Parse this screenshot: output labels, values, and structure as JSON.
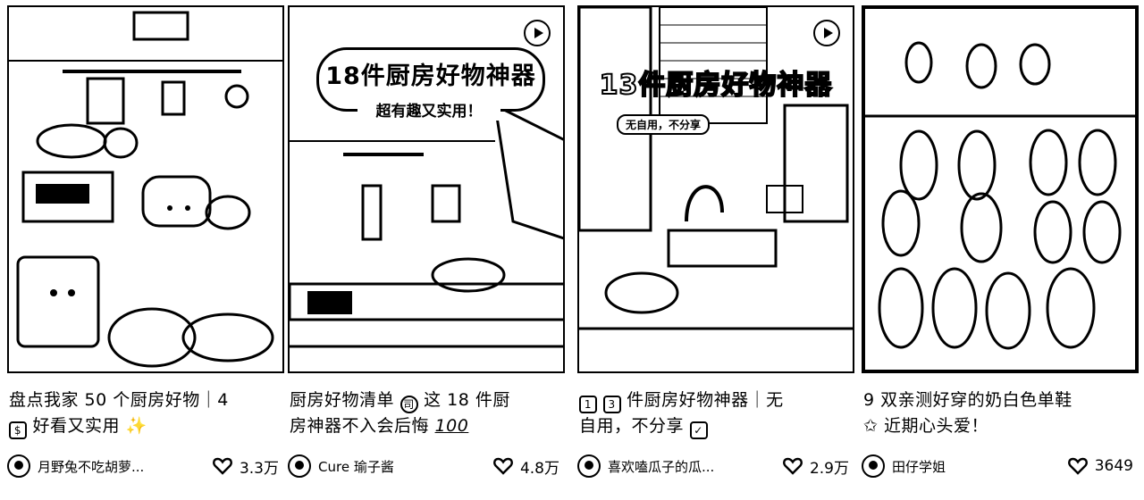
{
  "cards": [
    {
      "title_line1": "盘点我家 50 个厨房好物｜4",
      "title_line2": "好看又实用",
      "author": "月野兔不吃胡萝...",
      "likes": "3.3万",
      "has_play": false
    },
    {
      "title_line1": "厨房好物清单",
      "title_mid": "这 18 件厨",
      "title_line2": "房神器不入会后悔",
      "author": "Cure 瑜子酱",
      "likes": "4.8万",
      "overlay_title": "18件厨房好物神器",
      "overlay_sub": "超有趣又实用！",
      "has_play": true
    },
    {
      "title_line1": "件厨房好物神器｜无",
      "title_digits": [
        "1",
        "3"
      ],
      "title_line2": "自用，不分享",
      "author": "喜欢嗑瓜子的瓜...",
      "likes": "2.9万",
      "overlay_title": "13件厨房好物神器",
      "overlay_tag": "无自用，不分享",
      "has_play": true
    },
    {
      "title_line1": "9 双亲测好穿的奶白色单鞋",
      "title_line2": "近期心头爱！",
      "author": "田仔学姐",
      "likes": "3649",
      "has_play": false
    }
  ],
  "icons": {
    "like": "heart-icon",
    "play": "play-icon",
    "avatar": "avatar"
  }
}
